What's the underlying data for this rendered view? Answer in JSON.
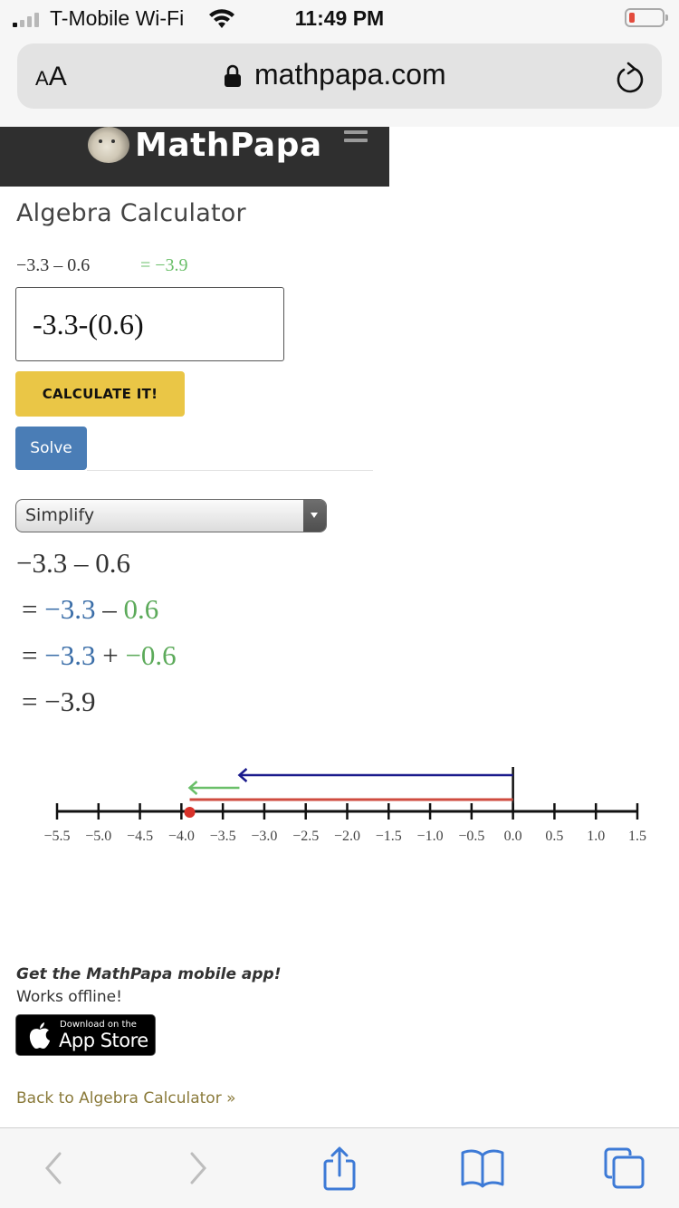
{
  "status_bar": {
    "carrier": "T-Mobile Wi-Fi",
    "time": "11:49 PM",
    "signal_bars_active": 1,
    "signal_bars_total": 4,
    "battery_level": "low"
  },
  "browser": {
    "text_size_button": {
      "small": "A",
      "large": "A"
    },
    "url": "mathpapa.com",
    "icons": [
      "lock-icon",
      "reload-icon"
    ],
    "toolbar": [
      "back-icon",
      "forward-icon",
      "share-icon",
      "bookmarks-icon",
      "tabs-icon"
    ]
  },
  "site": {
    "brand": "MathPapa",
    "page_title": "Algebra Calculator",
    "preview_expression": "−3.3 – 0.6",
    "preview_result": "= −3.9",
    "input_value": "-3.3-(0.6)",
    "calculate_label": "CALCULATE IT!",
    "solve_label": "Solve",
    "mode_selected": "Simplify",
    "steps": {
      "line0": {
        "text": "−3.3 – 0.6"
      },
      "line1": {
        "eq": "=",
        "a": "−3.3",
        "op": "–",
        "b": "0.6"
      },
      "line2": {
        "eq": "=",
        "a": "−3.3",
        "op": "+",
        "b": "−0.6"
      },
      "line3": {
        "eq": "=",
        "result": "−3.9"
      }
    },
    "colors": {
      "term_a": "#3b6ea8",
      "term_b": "#5caa5a",
      "calculate_button": "#eac646",
      "solve_button": "#4a7db6",
      "header_bg": "#2f2f2f"
    },
    "promo": {
      "title": "Get the MathPapa mobile app!",
      "subtitle": "Works offline!",
      "badge_small": "Download on the",
      "badge_big": "App Store"
    },
    "back_link": "Back to Algebra Calculator »"
  },
  "number_line": {
    "min": -5.5,
    "max": 1.5,
    "step": 0.5,
    "tick_labels": [
      "−5.5",
      "−5.0",
      "−4.5",
      "−4.0",
      "−3.5",
      "−3.0",
      "−2.5",
      "−2.0",
      "−1.5",
      "−1.0",
      "−0.5",
      "0.0",
      "0.5",
      "1.0",
      "1.5"
    ],
    "arrows": [
      {
        "name": "term-a-arrow",
        "from": 0,
        "to": -3.3,
        "color": "#1a1a8c"
      },
      {
        "name": "term-b-arrow",
        "from": -3.3,
        "to": -3.9,
        "color": "#6abf69"
      }
    ],
    "result_bar": {
      "from": 0,
      "to": -3.9,
      "color": "#cf4b3f"
    },
    "result_point": {
      "value": -3.9,
      "color": "#d8322a"
    },
    "origin_marker": 0
  }
}
